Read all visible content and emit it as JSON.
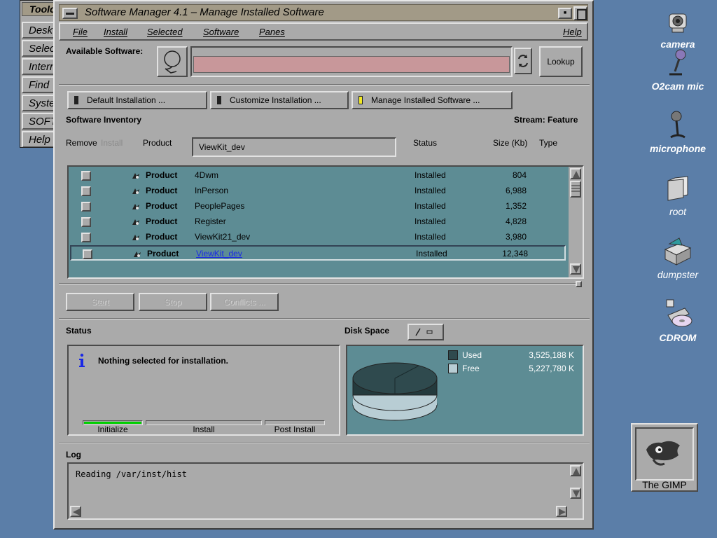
{
  "toolchest": {
    "title": "Toolc",
    "items": [
      "Desk",
      "Selec",
      "Intern",
      "Find",
      "Syste",
      "SOFT",
      "Help"
    ]
  },
  "window": {
    "title": "Software Manager 4.1 – Manage Installed Software",
    "menu": {
      "file": "File",
      "install": "Install",
      "selected": "Selected",
      "software": "Software",
      "panes": "Panes",
      "help": "Help"
    },
    "available_software_label": "Available Software:",
    "available_software_value": "",
    "lookup_button": "Lookup",
    "mode_buttons": {
      "default": "Default Installation ...",
      "customize": "Customize Installation ...",
      "manage": "Manage Installed Software ..."
    },
    "inventory_heading": "Software Inventory",
    "stream_label": "Stream: Feature",
    "columns": {
      "remove": "Remove",
      "install": "Install",
      "product": "Product",
      "status": "Status",
      "size": "Size (Kb)",
      "type": "Type"
    },
    "product_filter_value": "ViewKit_dev",
    "rows": [
      {
        "type": "Product",
        "name": "4Dwm",
        "status": "Installed",
        "size": "804"
      },
      {
        "type": "Product",
        "name": "InPerson",
        "status": "Installed",
        "size": "6,988"
      },
      {
        "type": "Product",
        "name": "PeoplePages",
        "status": "Installed",
        "size": "1,352"
      },
      {
        "type": "Product",
        "name": "Register",
        "status": "Installed",
        "size": "4,828"
      },
      {
        "type": "Product",
        "name": "ViewKit21_dev",
        "status": "Installed",
        "size": "3,980"
      },
      {
        "type": "Product",
        "name": "ViewKit_dev",
        "status": "Installed",
        "size": "12,348"
      }
    ],
    "selected_row": 5,
    "action_buttons": {
      "start": "Start",
      "stop": "Stop",
      "conflicts": "Conflicts ..."
    },
    "status_heading": "Status",
    "status_message": "Nothing selected for installation.",
    "progress": {
      "initialize": "Initialize",
      "install": "Install",
      "post_install": "Post Install",
      "initialize_fraction": 1.0,
      "install_fraction": 0.0,
      "post_install_fraction": 0.0
    },
    "disk_heading": "Disk Space",
    "disk": {
      "used_label": "Used",
      "used_value": "3,525,188 K",
      "free_label": "Free",
      "free_value": "5,227,780 K",
      "used_color": "#2f4a4e",
      "free_color": "#b8cdd4"
    },
    "log_heading": "Log",
    "log_text": "Reading /var/inst/hist"
  },
  "desktop_icons": {
    "camera": "camera",
    "o2cam": "O2cam mic",
    "microphone": "microphone",
    "root": "root",
    "dumpster": "dumpster",
    "cdrom": "CDROM",
    "gimp": "The GIMP"
  },
  "colors": {
    "desktop": "#5b7ea8",
    "window": "#aaaaaa",
    "titlebar": "#a29a87",
    "table": "#5d8c94",
    "input_pink": "#c8979a"
  }
}
